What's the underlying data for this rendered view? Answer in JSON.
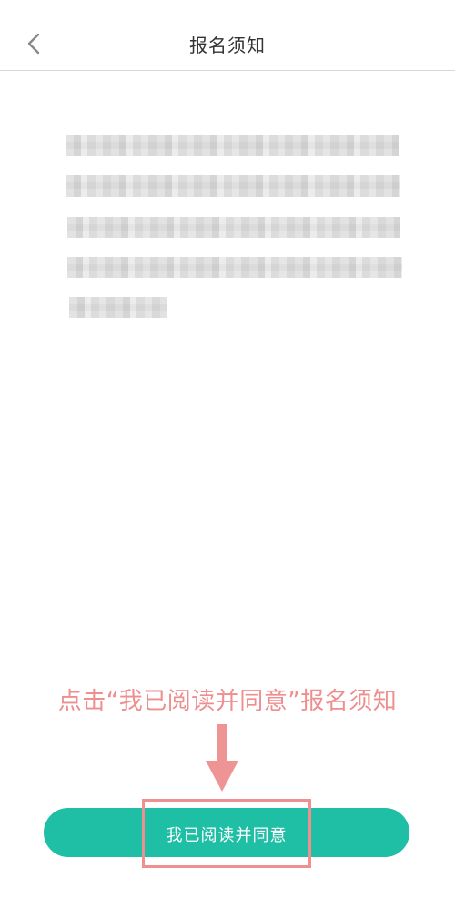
{
  "header": {
    "title": "报名须知",
    "back_icon": "chevron-left-icon"
  },
  "content": {
    "paragraph_lines": 5,
    "note": ""
  },
  "annotation": {
    "text": "点击“我已阅读并同意”报名须知",
    "color": "#ee8e8e",
    "arrow_icon": "arrow-down-icon"
  },
  "footer": {
    "agree_button_label": "我已阅读并同意",
    "agree_button_color": "#1ebfa5",
    "highlight_color": "#ef8f8f"
  }
}
